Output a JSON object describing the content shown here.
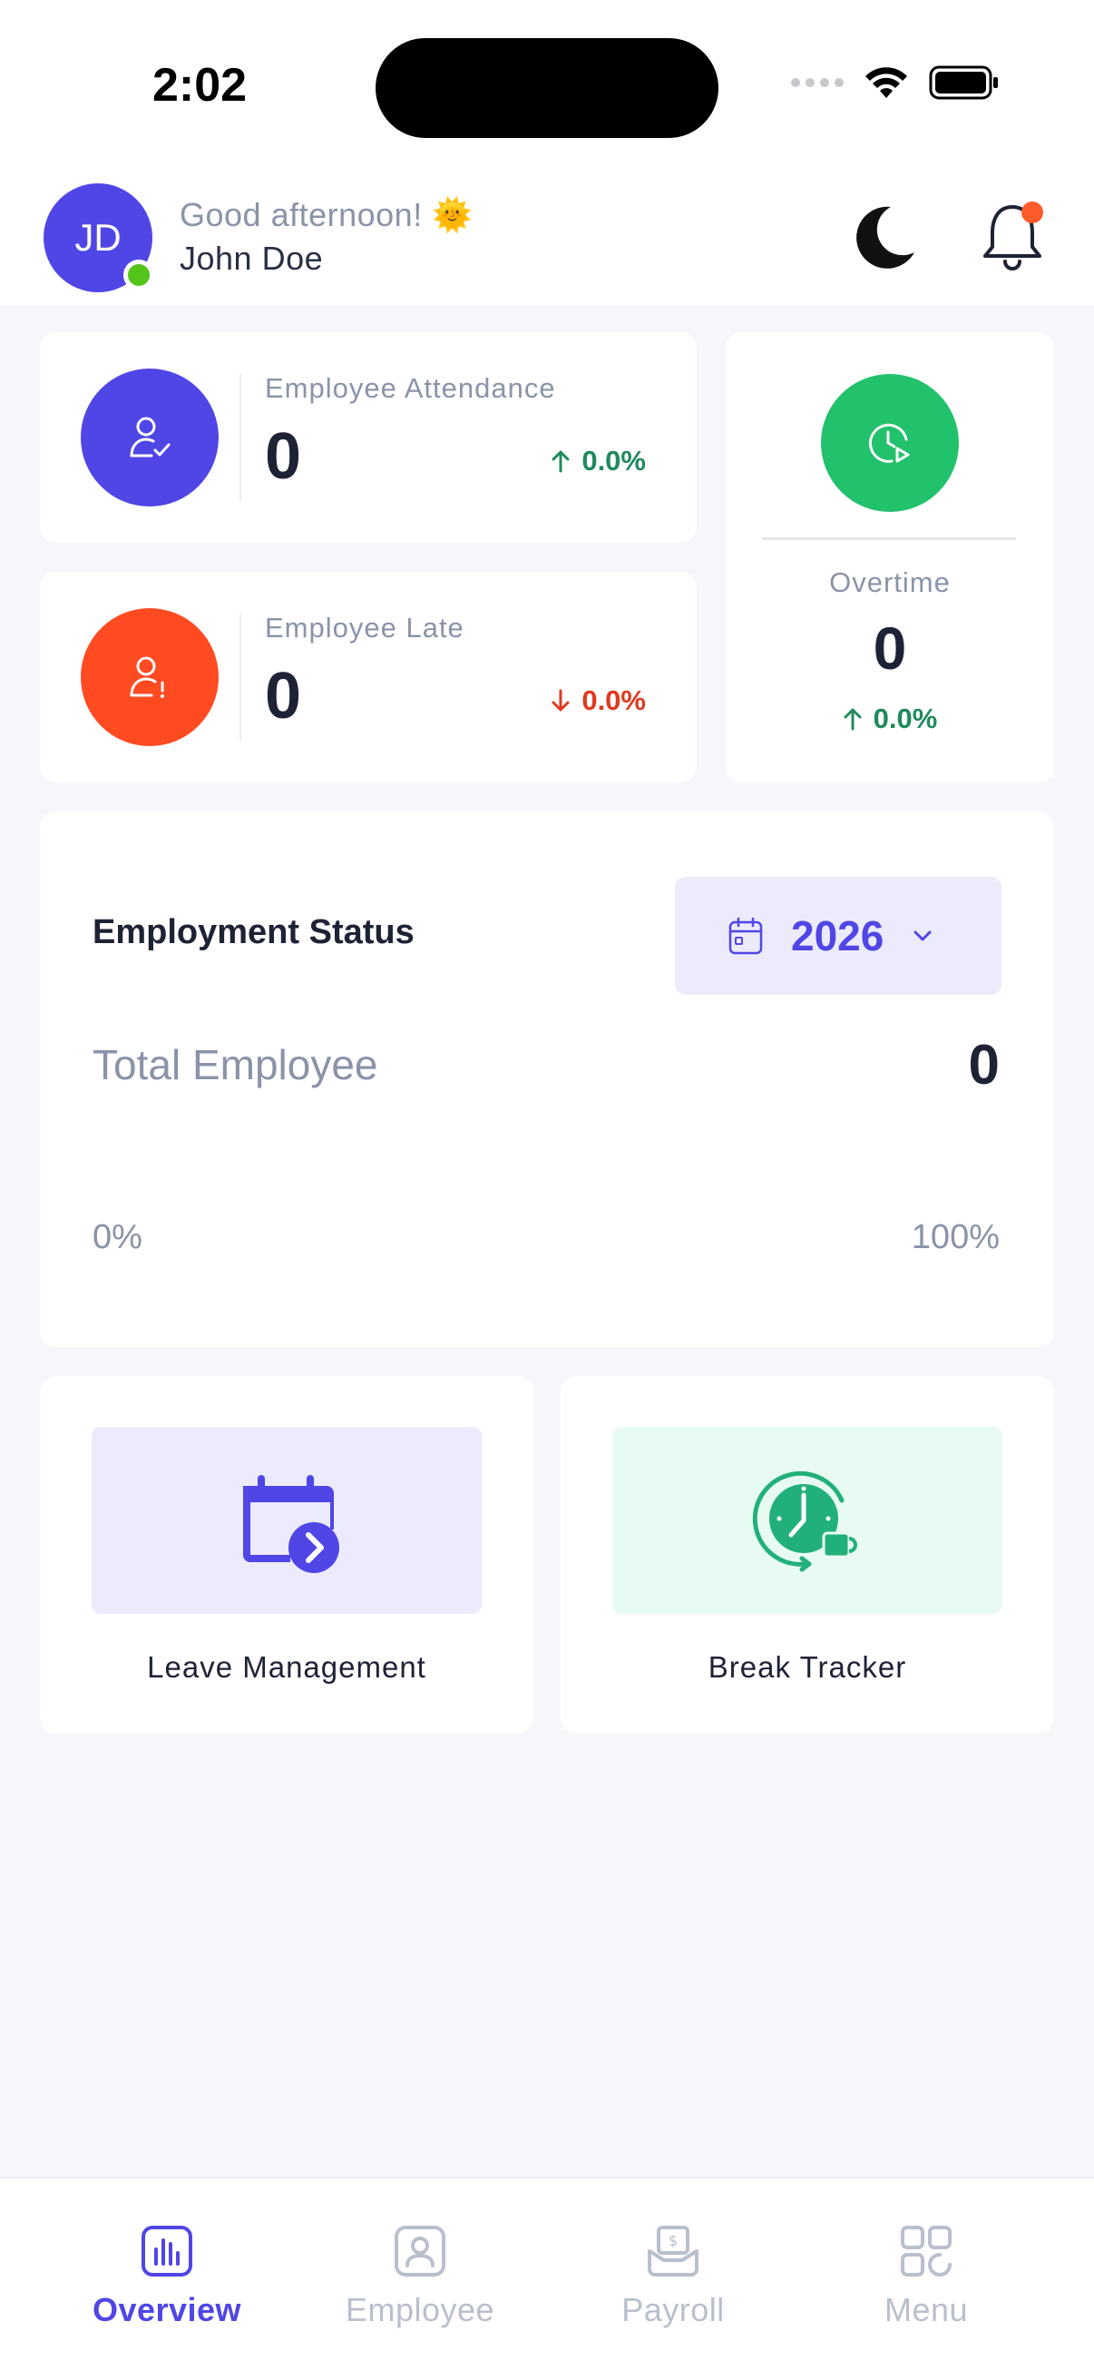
{
  "status_bar": {
    "time": "2:02"
  },
  "header": {
    "avatar_initials": "JD",
    "greeting": "Good afternoon! 🌞",
    "user_name": "John Doe"
  },
  "stats": {
    "attendance": {
      "label": "Employee Attendance",
      "value": "0",
      "trend": "0.0%",
      "trend_direction": "up"
    },
    "late": {
      "label": "Employee Late",
      "value": "0",
      "trend": "0.0%",
      "trend_direction": "down"
    },
    "overtime": {
      "label": "Overtime",
      "value": "0",
      "trend": "0.0%",
      "trend_direction": "up"
    }
  },
  "employment_status": {
    "title": "Employment Status",
    "year": "2026",
    "total_label": "Total Employee",
    "total_value": "0",
    "range_min": "0%",
    "range_max": "100%"
  },
  "features": [
    {
      "label": "Leave Management",
      "icon": "calendar-arrow-icon"
    },
    {
      "label": "Break Tracker",
      "icon": "clock-coffee-icon"
    }
  ],
  "bottom_nav": [
    {
      "label": "Overview",
      "icon": "chart-bars-icon",
      "active": true
    },
    {
      "label": "Employee",
      "icon": "person-badge-icon",
      "active": false
    },
    {
      "label": "Payroll",
      "icon": "payroll-icon",
      "active": false
    },
    {
      "label": "Menu",
      "icon": "grid-icon",
      "active": false
    }
  ],
  "colors": {
    "primary": "#5046e5",
    "attendance": "#5046e5",
    "late": "#ff4a22",
    "overtime": "#22c16b",
    "trend_up": "#1f8a5c",
    "trend_down": "#e0391e",
    "leave_bg": "#ecebfc",
    "break_bg": "#e8fbf3"
  }
}
